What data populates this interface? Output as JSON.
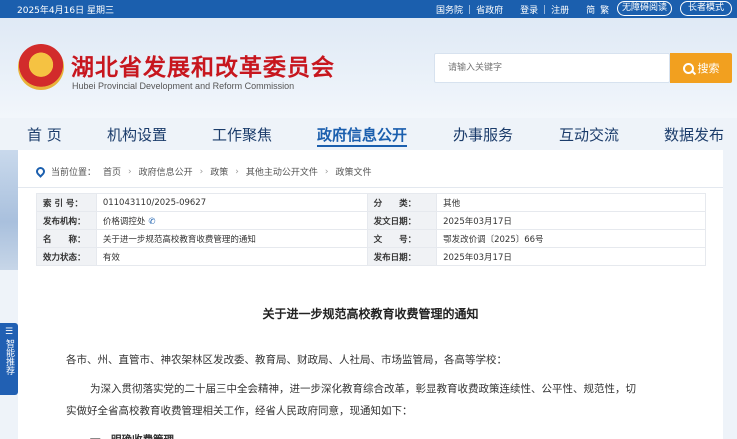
{
  "topbar": {
    "date": "2025年4月16日 星期三",
    "links": [
      "国务院",
      "|",
      "省政府",
      "登录",
      "|",
      "注册",
      "简",
      "繁"
    ],
    "accessibility": "无障碍阅读",
    "elder_mode": "长者模式"
  },
  "header": {
    "title": "湖北省发展和改革委员会",
    "subtitle": "Hubei Provincial Development and Reform Commission",
    "search_placeholder": "请输入关键字",
    "search_button": "搜索"
  },
  "nav": {
    "items": [
      "首 页",
      "机构设置",
      "工作聚焦",
      "政府信息公开",
      "办事服务",
      "互动交流",
      "数据发布"
    ],
    "active_index": 3
  },
  "breadcrumb": {
    "prefix": "当前位置：",
    "items": [
      "首页",
      "政府信息公开",
      "政策",
      "其他主动公开文件",
      "政策文件"
    ]
  },
  "info": {
    "rows": [
      {
        "l1": "索 引 号：",
        "v1": "011043110/2025-09627",
        "l2": "分　　类：",
        "v2": "其他"
      },
      {
        "l1": "发布机构：",
        "v1": "价格调控处",
        "l2": "发文日期：",
        "v2": "2025年03月17日"
      },
      {
        "l1": "名　　称：",
        "v1": "关于进一步规范高校教育收费管理的通知",
        "l2": "文　　号：",
        "v2": "鄂发改价调〔2025〕66号"
      },
      {
        "l1": "效力状态：",
        "v1": "有效",
        "l2": "发布日期：",
        "v2": "2025年03月17日"
      }
    ]
  },
  "document": {
    "title": "关于进一步规范高校教育收费管理的通知",
    "addressee": "各市、州、直管市、神农架林区发改委、教育局、财政局、人社局、市场监管局，各高等学校：",
    "para1_line1": "为深入贯彻落实党的二十届三中全会精神，进一步深化教育综合改革，彰显教育收费政策连续性、公平性、规范性，切",
    "para1_line2": "实做好全省高校教育收费管理相关工作，经省人民政府同意，现通知如下：",
    "section1": "一、明确收费管理"
  },
  "side_widget": "智能推荐",
  "colors": {
    "brand_red": "#c7161e",
    "brand_blue": "#1b5fae",
    "accent_orange": "#f2a01f"
  }
}
